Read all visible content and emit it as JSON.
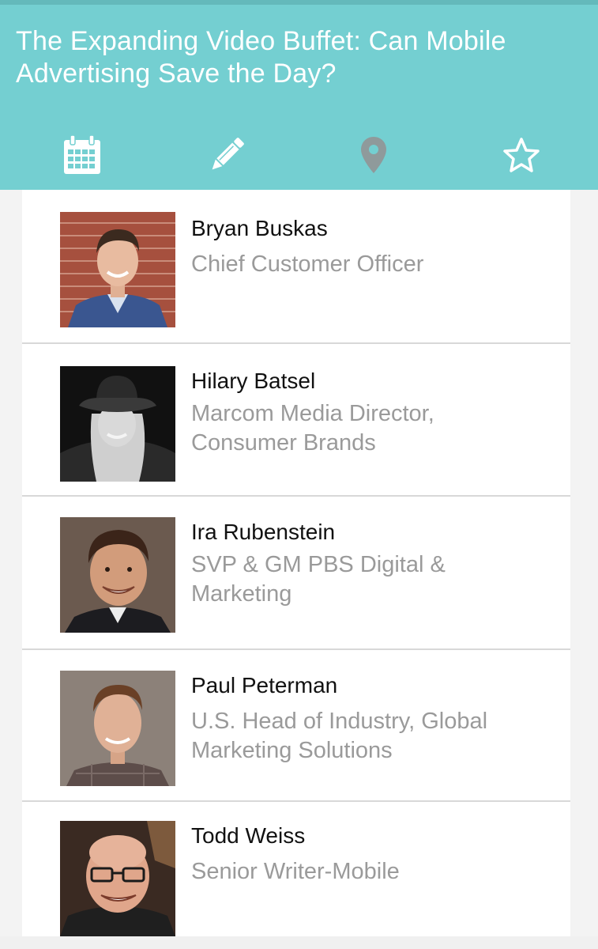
{
  "session": {
    "title": "The Expanding Video Buffet: Can Mobile Advertising Save the Day?"
  },
  "tabs": [
    {
      "icon": "calendar-icon",
      "active": true
    },
    {
      "icon": "pencil-icon",
      "active": false
    },
    {
      "icon": "map-pin-icon",
      "active": false
    },
    {
      "icon": "star-icon",
      "active": false
    }
  ],
  "colors": {
    "header_bg": "#74cfd1",
    "tab_icon": "#ffffff",
    "tab_icon_muted": "#8f9a9b",
    "name_text": "#111111",
    "role_text": "#9a9a9a",
    "divider": "#d8d8d8"
  },
  "speakers": [
    {
      "name": "Bryan Buskas",
      "role": "Chief Customer Officer"
    },
    {
      "name": "Hilary Batsel",
      "role": "Marcom Media Director, Consumer Brands"
    },
    {
      "name": "Ira Rubenstein",
      "role": "SVP & GM PBS Digital & Marketing"
    },
    {
      "name": "Paul Peterman",
      "role": "U.S. Head of Industry, Global Marketing Solutions"
    },
    {
      "name": "Todd Weiss",
      "role": "Senior Writer-Mobile"
    }
  ]
}
